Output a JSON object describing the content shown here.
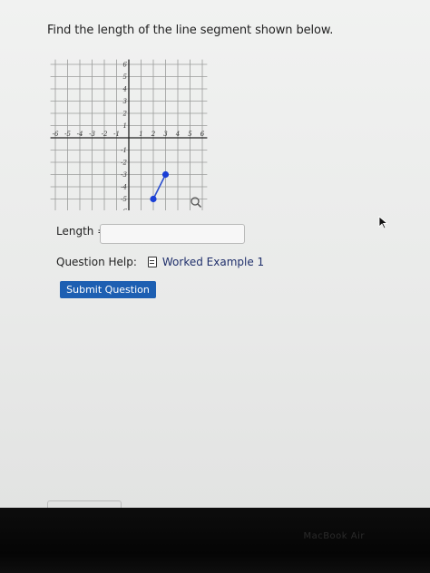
{
  "question": {
    "prompt": "Find the length of the line segment shown below."
  },
  "graph": {
    "x_ticks": [
      "-6",
      "-5",
      "-4",
      "-3",
      "-2",
      "-1",
      "1",
      "2",
      "3",
      "4",
      "5",
      "6"
    ],
    "y_ticks": [
      "6",
      "5",
      "4",
      "3",
      "2",
      "1",
      "-1",
      "-2",
      "-3",
      "-4",
      "-5",
      "-6"
    ],
    "x_range": [
      -6,
      6
    ],
    "y_range": [
      -6,
      6
    ],
    "segment": {
      "start": [
        2,
        -5
      ],
      "end": [
        3,
        -3
      ]
    },
    "point_color": "#1a3fd6",
    "line_color": "#2b4fcf",
    "zoom_icon": "magnifier-icon"
  },
  "answer": {
    "label": "Length =",
    "value": "",
    "placeholder": ""
  },
  "help": {
    "label": "Question Help:",
    "link": "Worked Example 1",
    "icon": "document-icon"
  },
  "submit": {
    "label": "Submit Question",
    "color": "#1d5fb2"
  },
  "bezel": {
    "brand": "MacBook Air"
  }
}
